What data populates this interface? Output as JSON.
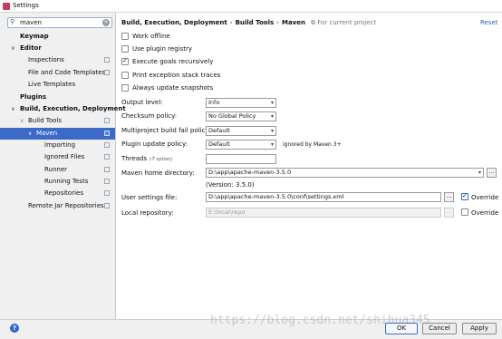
{
  "window": {
    "title": "Settings"
  },
  "search": {
    "value": "maven",
    "icon": "search-icon"
  },
  "sidebar": {
    "items": [
      {
        "label": "Keymap",
        "bold": true
      },
      {
        "label": "Editor",
        "bold": true,
        "arrow": "∨"
      },
      {
        "label": "Inspections"
      },
      {
        "label": "File and Code Templates"
      },
      {
        "label": "Live Templates"
      },
      {
        "label": "Plugins",
        "bold": true
      },
      {
        "label": "Build, Execution, Deployment",
        "bold": true,
        "arrow": "∨"
      },
      {
        "label": "Build Tools",
        "arrow": "∨"
      },
      {
        "label": "Maven",
        "selected": true,
        "arrow": "∨"
      },
      {
        "label": "Importing"
      },
      {
        "label": "Ignored Files"
      },
      {
        "label": "Runner"
      },
      {
        "label": "Running Tests"
      },
      {
        "label": "Repositories"
      },
      {
        "label": "Remote Jar Repositories"
      }
    ]
  },
  "breadcrumb": {
    "part1": "Build, Execution, Deployment",
    "sep": "›",
    "part2": "Build Tools",
    "part3": "Maven",
    "scope": "For current project"
  },
  "reset_label": "Reset",
  "checkboxes": [
    {
      "label": "Work offline",
      "checked": false
    },
    {
      "label": "Use plugin registry",
      "checked": false
    },
    {
      "label": "Execute goals recursively",
      "checked": true
    },
    {
      "label": "Print exception stack traces",
      "checked": false
    },
    {
      "label": "Always update snapshots",
      "checked": false
    }
  ],
  "form": {
    "output_level": {
      "label": "Output level:",
      "value": "Info"
    },
    "checksum_policy": {
      "label": "Checksum policy:",
      "value": "No Global Policy"
    },
    "multiproject_fail": {
      "label": "Multiproject build fail policy:",
      "value": "Default"
    },
    "plugin_update": {
      "label": "Plugin update policy:",
      "value": "Default",
      "note": "ignored by Maven 3+"
    },
    "threads": {
      "label": "Threads",
      "hint": "(-T option)",
      "value": ""
    },
    "maven_home": {
      "label": "Maven home directory:",
      "value": "D:\\app\\apache-maven-3.5.0",
      "version": "(Version: 3.5.0)"
    },
    "user_settings": {
      "label": "User settings file:",
      "value": "D:\\app\\apache-maven-3.5.0\\conf\\settings.xml",
      "override_label": "Override",
      "override_checked": true
    },
    "local_repo": {
      "label": "Local repository:",
      "value": "E:\\local\\repo",
      "override_label": "Override",
      "override_checked": false
    }
  },
  "buttons": {
    "browse": "...",
    "ok": "OK",
    "cancel": "Cancel",
    "apply": "Apply",
    "help": "?"
  },
  "watermark": "https://blog.csdn.net/shihua345"
}
